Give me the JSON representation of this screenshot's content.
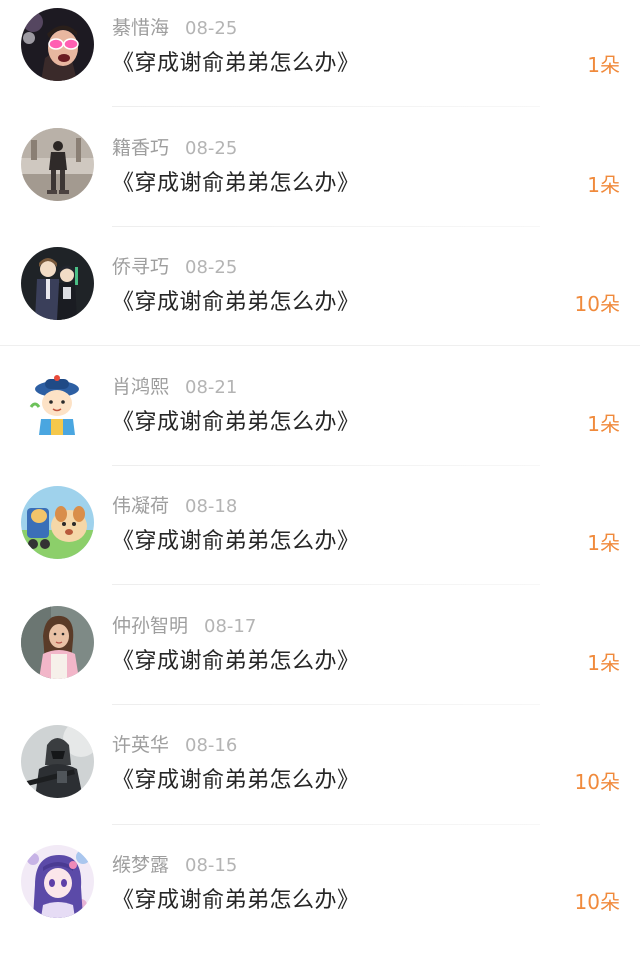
{
  "items": [
    {
      "name": "綦惜海",
      "date": "08-25",
      "book": "《穿成谢俞弟弟怎么办》",
      "count": "1朵",
      "avatar_icon": "avatar-pink-glasses"
    },
    {
      "name": "籍香巧",
      "date": "08-25",
      "book": "《穿成谢俞弟弟怎么办》",
      "count": "1朵",
      "avatar_icon": "avatar-person-walking"
    },
    {
      "name": "侨寻巧",
      "date": "08-25",
      "book": "《穿成谢俞弟弟怎么办》",
      "count": "10朵",
      "avatar_icon": "avatar-anime-pair"
    },
    {
      "name": "肖鸿熙",
      "date": "08-21",
      "book": "《穿成谢俞弟弟怎么办》",
      "count": "1朵",
      "avatar_icon": "avatar-cartoon-official"
    },
    {
      "name": "伟凝荷",
      "date": "08-18",
      "book": "《穿成谢俞弟弟怎么办》",
      "count": "1朵",
      "avatar_icon": "avatar-cartoon-dogs"
    },
    {
      "name": "仲孙智明",
      "date": "08-17",
      "book": "《穿成谢俞弟弟怎么办》",
      "count": "1朵",
      "avatar_icon": "avatar-woman-portrait"
    },
    {
      "name": "许英华",
      "date": "08-16",
      "book": "《穿成谢俞弟弟怎么办》",
      "count": "10朵",
      "avatar_icon": "avatar-armored-soldier"
    },
    {
      "name": "缑梦露",
      "date": "08-15",
      "book": "《穿成谢俞弟弟怎么办》",
      "count": "10朵",
      "avatar_icon": "avatar-anime-girl"
    }
  ]
}
